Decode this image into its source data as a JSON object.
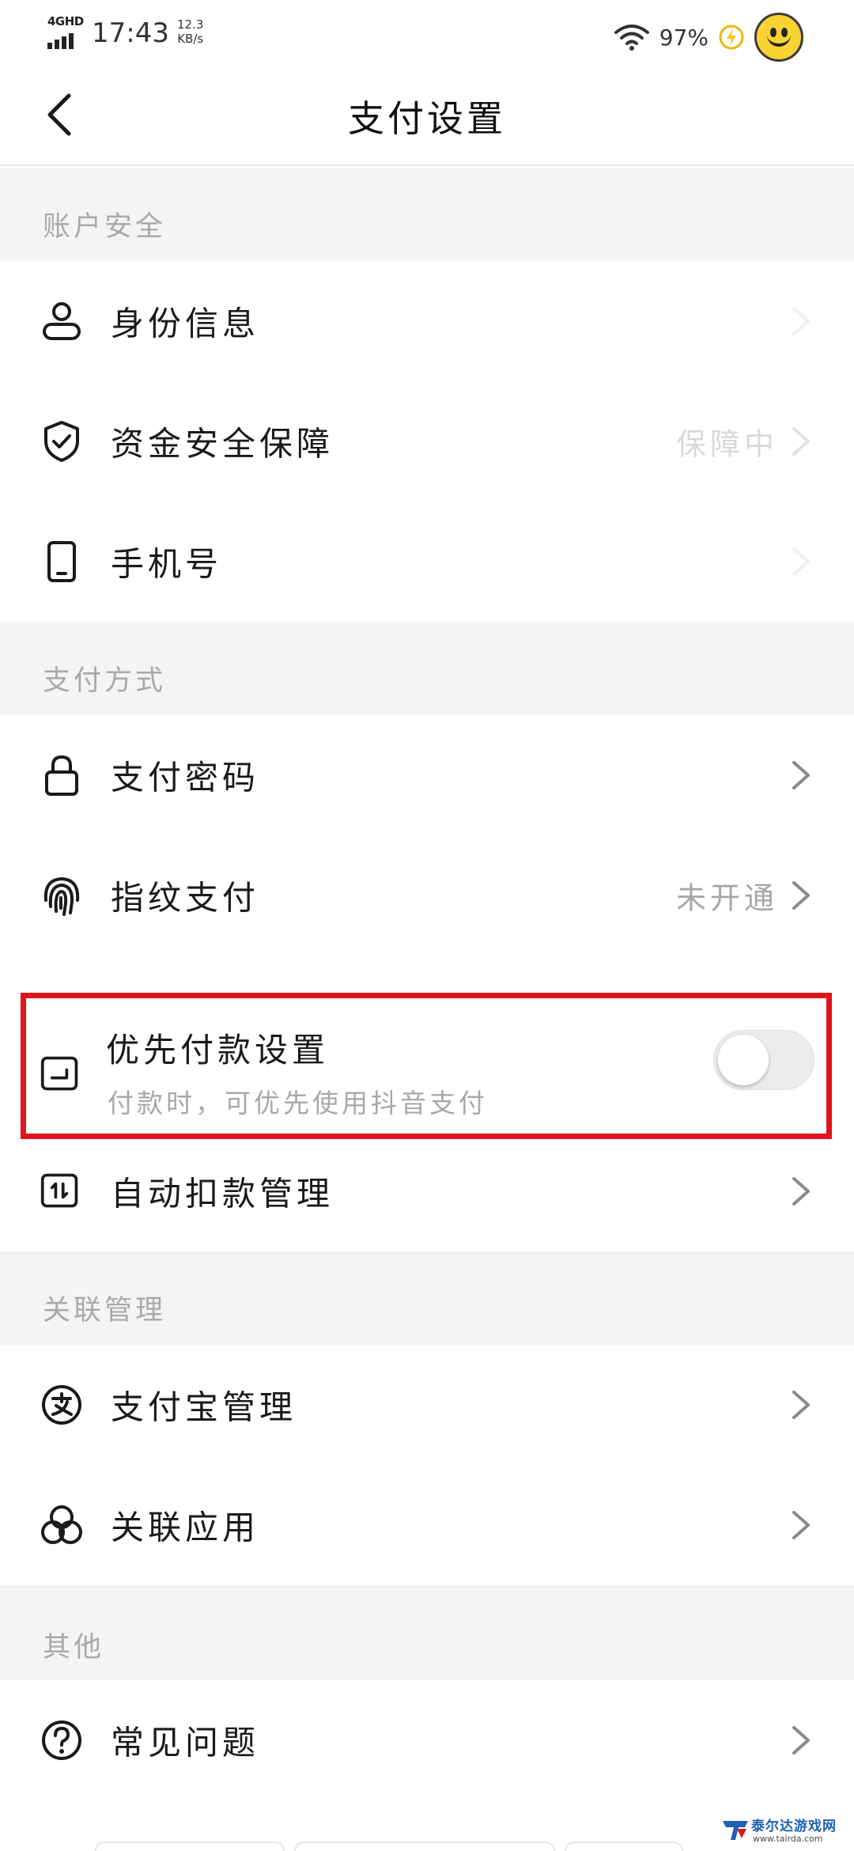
{
  "status_bar": {
    "network": "4GHD",
    "time": "17:43",
    "speed_value": "12.3",
    "speed_unit": "KB/s",
    "battery": "97%",
    "icons": [
      "signal-icon",
      "wifi-icon",
      "charging-icon",
      "smiley-icon"
    ]
  },
  "header": {
    "title": "支付设置",
    "back_icon": "back-arrow-icon"
  },
  "sections": {
    "account_security": {
      "title": "账户安全",
      "items": [
        {
          "label": "身份信息",
          "icon": "user-icon"
        },
        {
          "label": "资金安全保障",
          "icon": "shield-icon",
          "value": "保障中"
        },
        {
          "label": "手机号",
          "icon": "phone-icon"
        }
      ]
    },
    "payment_methods": {
      "title": "支付方式",
      "items": [
        {
          "label": "支付密码",
          "icon": "lock-icon"
        },
        {
          "label": "指纹支付",
          "icon": "fingerprint-icon",
          "value": "未开通"
        },
        {
          "label": "优先付款设置",
          "icon": "priority-pay-icon",
          "sublabel": "付款时，可优先使用抖音支付",
          "toggle_on": false
        },
        {
          "label": "自动扣款管理",
          "icon": "auto-deduct-icon"
        }
      ]
    },
    "linked_management": {
      "title": "关联管理",
      "items": [
        {
          "label": "支付宝管理",
          "icon": "alipay-icon"
        },
        {
          "label": "关联应用",
          "icon": "linked-apps-icon"
        }
      ]
    },
    "other": {
      "title": "其他",
      "items": [
        {
          "label": "常见问题",
          "icon": "help-icon"
        }
      ]
    }
  },
  "watermark": {
    "text": "泰尔达游戏网",
    "url": "www.tairda.com"
  },
  "colors": {
    "highlight": "#e0141c",
    "section_bg": "#f4f4f4",
    "secondary_text": "#a8a8a8"
  }
}
